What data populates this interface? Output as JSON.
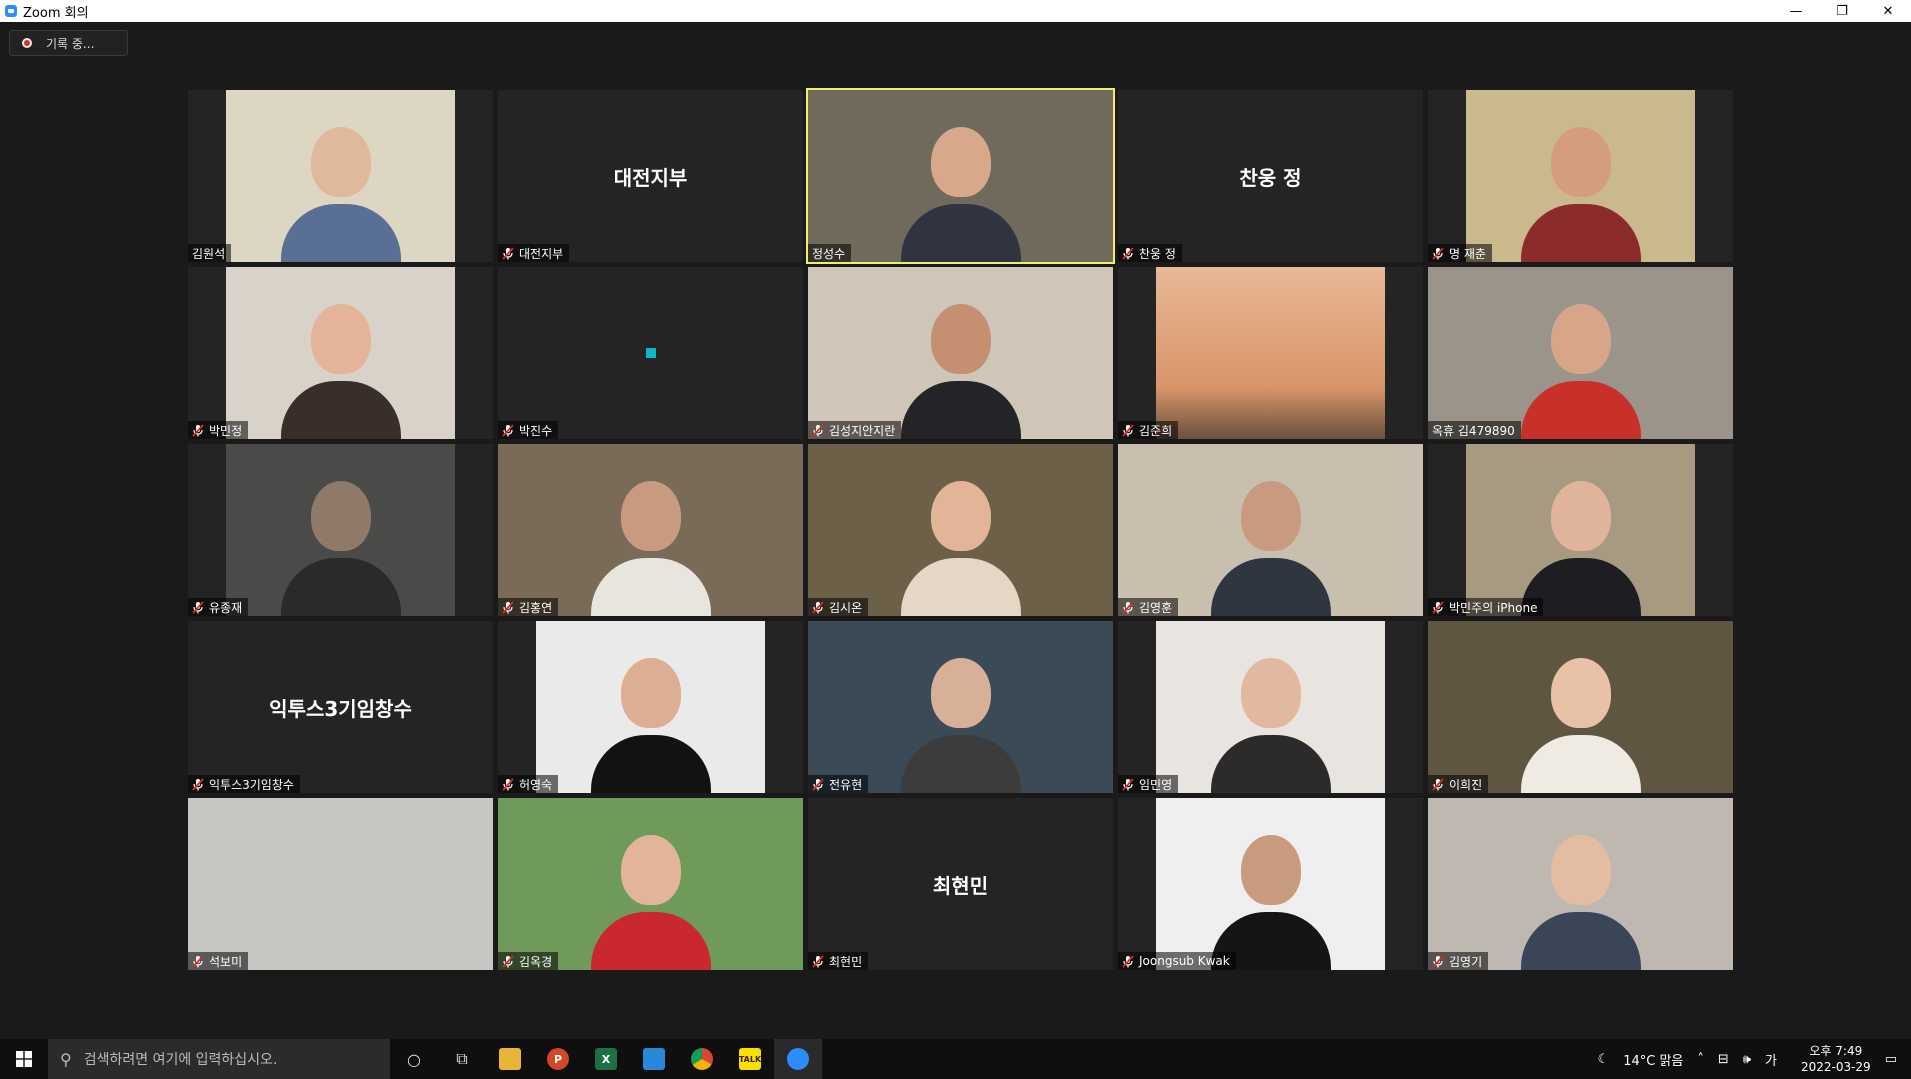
{
  "window": {
    "title": "Zoom 회의",
    "controls": [
      "—",
      "❐",
      "✕"
    ]
  },
  "recording": {
    "label": "기록 중..."
  },
  "participants": [
    {
      "name": "김원석",
      "muted": false,
      "video": true,
      "skin": "#e0b89c",
      "shirt": "#5a6f95",
      "bg": "#dcd6c3"
    },
    {
      "name": "대전지부",
      "muted": true,
      "video": false,
      "display": "대전지부"
    },
    {
      "name": "정성수",
      "muted": false,
      "video": true,
      "active": true,
      "skin": "#d8a88a",
      "shirt": "#2f3440",
      "bg": "#6f6a5c"
    },
    {
      "name": "찬웅 정",
      "muted": true,
      "video": false,
      "display": "찬웅 정"
    },
    {
      "name": "명 재춘",
      "muted": true,
      "video": true,
      "skin": "#d49e7c",
      "shirt": "#8c2b2b",
      "bg": "#c9b98d"
    },
    {
      "name": "박민정",
      "muted": true,
      "video": true,
      "skin": "#e4b49a",
      "shirt": "#3a2e2a",
      "bg": "#d8d2c8"
    },
    {
      "name": "박진수",
      "muted": true,
      "video": false,
      "display": ""
    },
    {
      "name": "김성지안지란",
      "muted": true,
      "video": true,
      "skin": "#c59072",
      "shirt": "#222428",
      "bg": "#cfc6b7"
    },
    {
      "name": "김준희",
      "muted": true,
      "video": true,
      "sky": true,
      "bg": "#e0a872"
    },
    {
      "name": "옥휴 김479890",
      "muted": false,
      "video": true,
      "skin": "#d7a689",
      "shirt": "#c8302a",
      "bg": "#9a948a"
    },
    {
      "name": "유종재",
      "muted": true,
      "video": true,
      "skin": "#8f7a6a",
      "shirt": "#2a2a2a",
      "bg": "#4a4a48"
    },
    {
      "name": "김홍연",
      "muted": true,
      "video": true,
      "skin": "#c89a80",
      "shirt": "#e8e4de",
      "bg": "#7a6a58"
    },
    {
      "name": "김시온",
      "muted": true,
      "video": true,
      "skin": "#e2b599",
      "shirt": "#e6d6c6",
      "bg": "#6c6048"
    },
    {
      "name": "김영훈",
      "muted": true,
      "video": true,
      "skin": "#c89a80",
      "shirt": "#2e3640",
      "bg": "#c8bfae"
    },
    {
      "name": "박민주의 iPhone",
      "muted": true,
      "video": true,
      "skin": "#e0b49a",
      "shirt": "#1e1e22",
      "bg": "#a89a80"
    },
    {
      "name": "익투스3기임창수",
      "muted": true,
      "video": false,
      "display": "익투스3기임창수"
    },
    {
      "name": "허영숙",
      "muted": true,
      "video": true,
      "skin": "#dcae92",
      "shirt": "#121212",
      "bg": "#eaeaea"
    },
    {
      "name": "전유현",
      "muted": true,
      "video": true,
      "skin": "#d8b097",
      "shirt": "#3c3c3c",
      "bg": "#3a4a56"
    },
    {
      "name": "임민영",
      "muted": true,
      "video": true,
      "skin": "#e2b8a0",
      "shirt": "#2c2a2a",
      "bg": "#e8e4e0"
    },
    {
      "name": "이희진",
      "muted": true,
      "video": true,
      "skin": "#e8c2a6",
      "shirt": "#efeae2",
      "bg": "#5e5640"
    },
    {
      "name": "석보미",
      "muted": true,
      "video": true,
      "room": true,
      "bg": "#c8c6c2"
    },
    {
      "name": "김옥경",
      "muted": true,
      "video": true,
      "skin": "#e2b49a",
      "shirt": "#c8282e",
      "bg": "#6f9a5a"
    },
    {
      "name": "최현민",
      "muted": true,
      "video": false,
      "display": "최현민"
    },
    {
      "name": "Joongsub Kwak",
      "muted": true,
      "video": true,
      "skin": "#c89a7e",
      "shirt": "#151515",
      "bg": "#efefef"
    },
    {
      "name": "김영기",
      "muted": true,
      "video": true,
      "skin": "#e4bca2",
      "shirt": "#3a4658",
      "bg": "#bfb8b0"
    }
  ],
  "taskbar": {
    "search_placeholder": "검색하려면 여기에 입력하십시오.",
    "weather": "14°C  맑음",
    "ime": "가",
    "time": "오후 7:49",
    "date": "2022-03-29"
  }
}
